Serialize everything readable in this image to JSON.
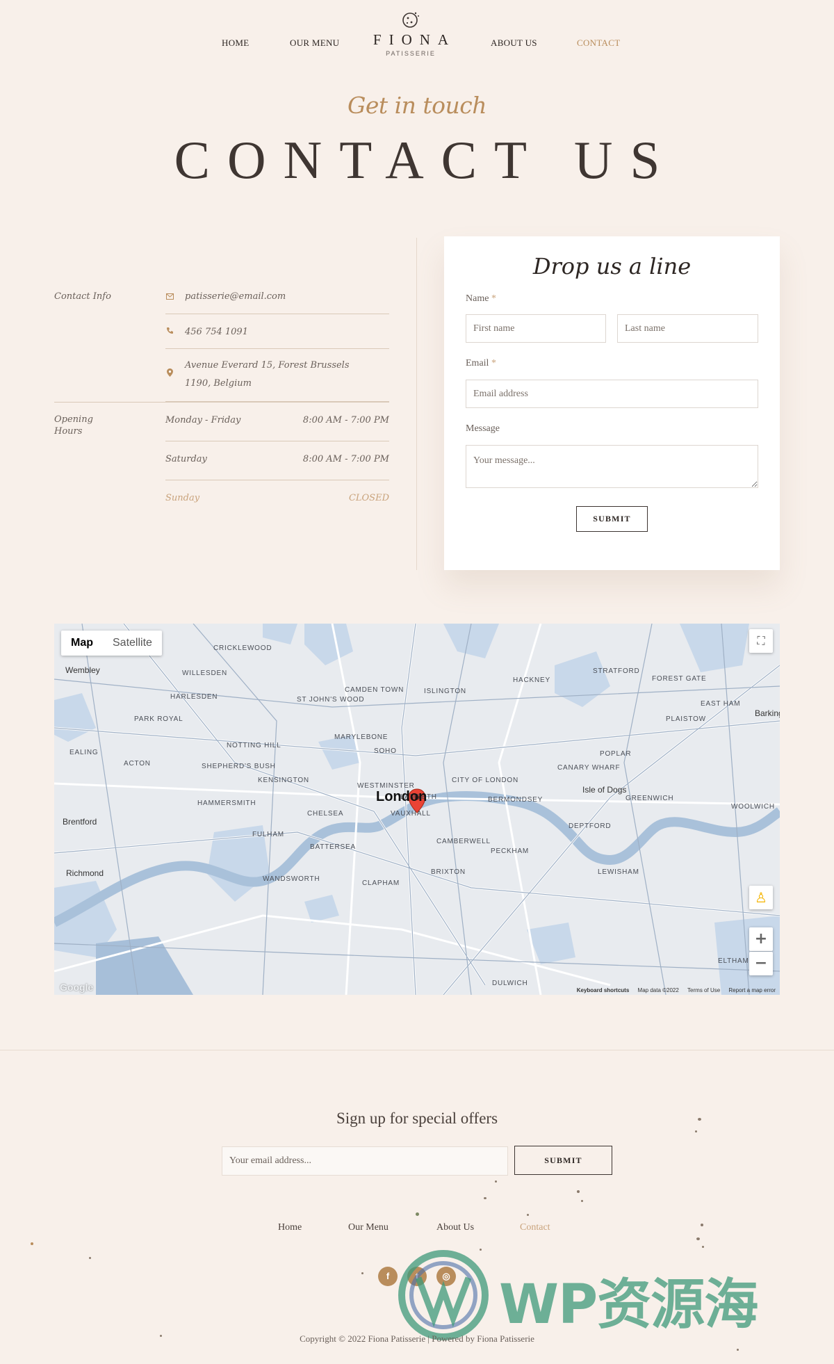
{
  "nav": {
    "items": [
      {
        "label": "HOME",
        "left": 0
      },
      {
        "label": "OUR MENU",
        "left": 0
      },
      {
        "label": "ABOUT US",
        "left": 0
      },
      {
        "label": "CONTACT",
        "left": 0
      }
    ]
  },
  "logo": {
    "name": "FIONA",
    "sub": "PATISSERIE"
  },
  "hero": {
    "script": "Get in touch",
    "title": "CONTACT US"
  },
  "contact": {
    "info_label": "Contact Info",
    "email": "patisserie@email.com",
    "phone": "456 754 1091",
    "address": "Avenue Everard 15, Forest Brussels 1190, Belgium",
    "hours_label": "Opening Hours",
    "hours": [
      {
        "day": "Monday - Friday",
        "time": "8:00 AM - 7:00 PM"
      },
      {
        "day": "Saturday",
        "time": "8:00 AM - 7:00 PM"
      },
      {
        "day": "Sunday",
        "time": "CLOSED"
      }
    ]
  },
  "form": {
    "title": "Drop us a line",
    "name_label": "Name",
    "required_mark": "*",
    "first_placeholder": "First name",
    "last_placeholder": "Last name",
    "email_label": "Email",
    "email_placeholder": "Email address",
    "message_label": "Message",
    "message_placeholder": "Your message...",
    "submit": "SUBMIT"
  },
  "map": {
    "tab_map": "Map",
    "tab_satellite": "Satellite",
    "city": "London",
    "labels": [
      "CRICKLEWOOD",
      "Wembley",
      "WILLESDEN",
      "HARLESDEN",
      "PARK ROYAL",
      "EALING",
      "ACTON",
      "NOTTING HILL",
      "SHEPHERD'S BUSH",
      "KENSINGTON",
      "HAMMERSMITH",
      "CHELSEA",
      "FULHAM",
      "Brentford",
      "Richmond",
      "WANDSWORTH",
      "BATTERSEA",
      "CLAPHAM",
      "BRIXTON",
      "CAMBERWELL",
      "PECKHAM",
      "LAMBETH",
      "VAUXHALL",
      "WESTMINSTER",
      "SOHO",
      "MARYLEBONE",
      "ST JOHN'S WOOD",
      "CAMDEN TOWN",
      "ISLINGTON",
      "HACKNEY",
      "STRATFORD",
      "FOREST GATE",
      "EAST HAM",
      "PLAISTOW",
      "POPLAR",
      "CANARY WHARF",
      "Isle of Dogs",
      "GREENWICH",
      "WOOLWICH",
      "DEPTFORD",
      "LEWISHAM",
      "BERMONDSEY",
      "CITY OF LONDON",
      "DULWICH",
      "ELTHAM",
      "Barking"
    ],
    "footer": [
      "Keyboard shortcuts",
      "Map data ©2022",
      "Terms of Use",
      "Report a map error"
    ],
    "google": "Google",
    "zoom_in": "+",
    "zoom_out": "−"
  },
  "newsletter": {
    "title": "Sign up for special offers",
    "placeholder": "Your email address...",
    "submit": "SUBMIT"
  },
  "footer": {
    "links": [
      "Home",
      "Our Menu",
      "About Us",
      "Contact"
    ],
    "social": [
      "f",
      "t",
      "◎"
    ],
    "copyright": "Copyright © 2022 Fiona Patisserie | Powered by Fiona Patisserie"
  },
  "watermark": {
    "text": "WP资源海"
  },
  "colors": {
    "accent": "#b98d5c",
    "background": "#f8f0ea",
    "text": "#3c3431"
  }
}
